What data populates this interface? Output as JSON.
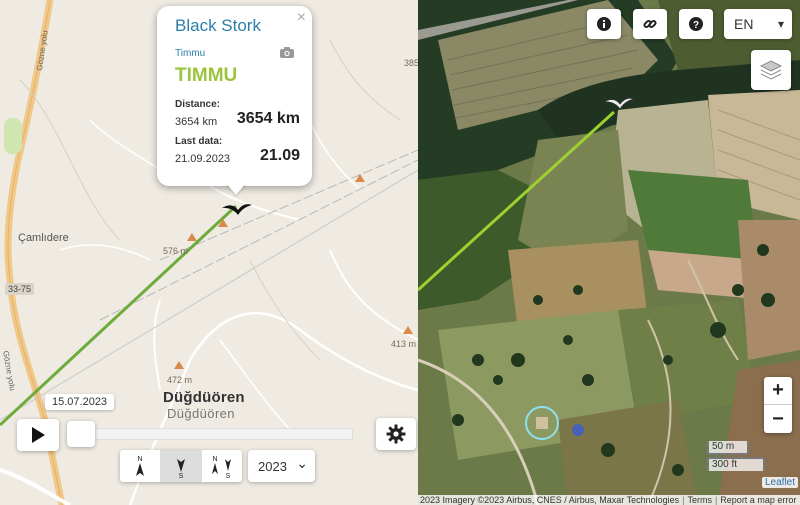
{
  "popup": {
    "species": "Black Stork",
    "bird_small": "Timmu",
    "bird_name": "TIMMU",
    "distance_label": "Distance:",
    "distance_small": "3654 km",
    "distance_big": "3654 km",
    "last_data_label": "Last data:",
    "last_data_small": "21.09.2023",
    "last_data_big": "21.09",
    "close_glyph": "×",
    "camera_icon": "camera-icon"
  },
  "map_labels": {
    "camlidere": "Çamlıdere",
    "dugduoren": "Düğdüören",
    "dugduoren_ghost": "Düğdüören",
    "road_shield": "33-75",
    "road_name_1": "Gözne yolu",
    "road_name_2": "Gözne yolu",
    "elev_576": "576 m",
    "elev_472": "472 m",
    "elev_413": "413 m",
    "elev_385": "385"
  },
  "controls": {
    "language": "EN",
    "language_caret": "▾",
    "info_icon": "info-icon",
    "link_icon": "link-icon",
    "help_icon": "help-icon",
    "layers_icon": "layers-icon",
    "zoom_in": "+",
    "zoom_out": "−",
    "scale_m": "50 m",
    "scale_ft": "300 ft"
  },
  "timeline": {
    "date": "15.07.2023",
    "year": "2023",
    "year_caret": "⌄",
    "play_icon": "play-icon",
    "settings_icon": "gear-icon",
    "progress": 0.04,
    "direction_buttons": [
      "north-up",
      "south",
      "north-south"
    ],
    "active_direction": 1
  },
  "attribution": {
    "imagery": "2023 Imagery ©2023 Airbus, CNES / Airbus, Maxar Technologies",
    "terms": "Terms",
    "report": "Report a map error",
    "leaflet": "Leaflet"
  },
  "colors": {
    "track_line": "#9cd22f",
    "accent_blue": "#2a7fa8",
    "accent_green": "#9cc43b"
  }
}
